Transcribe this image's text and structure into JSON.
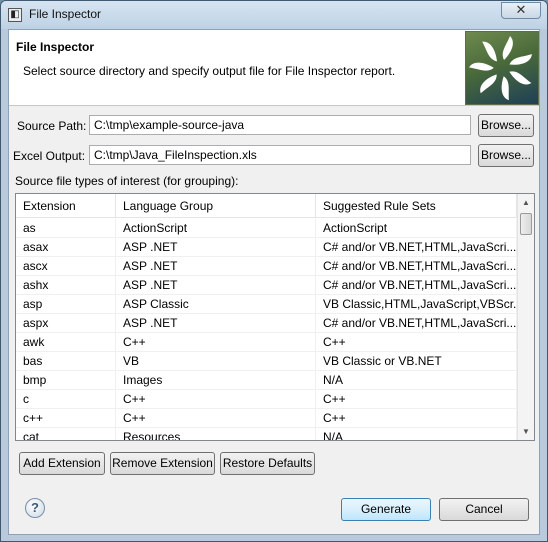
{
  "window": {
    "title": "File Inspector",
    "close_glyph": "✕"
  },
  "banner": {
    "title": "File Inspector",
    "description": "Select source directory and specify output file for File Inspector report."
  },
  "source_path": {
    "label": "Source Path:",
    "value": "C:\\tmp\\example-source-java",
    "browse_label": "Browse..."
  },
  "excel_output": {
    "label": "Excel Output:",
    "value": "C:\\tmp\\Java_FileInspection.xls",
    "browse_label": "Browse..."
  },
  "types_label": "Source file types of interest (for grouping):",
  "table": {
    "columns": [
      "Extension",
      "Language Group",
      "Suggested Rule Sets"
    ],
    "rows": [
      [
        "as",
        "ActionScript",
        "ActionScript"
      ],
      [
        "asax",
        "ASP .NET",
        "C# and/or VB.NET,HTML,JavaScri..."
      ],
      [
        "ascx",
        "ASP .NET",
        "C# and/or VB.NET,HTML,JavaScri..."
      ],
      [
        "ashx",
        "ASP .NET",
        "C# and/or VB.NET,HTML,JavaScri..."
      ],
      [
        "asp",
        "ASP Classic",
        "VB Classic,HTML,JavaScript,VBScr..."
      ],
      [
        "aspx",
        "ASP .NET",
        "C# and/or VB.NET,HTML,JavaScri..."
      ],
      [
        "awk",
        "C++",
        "C++"
      ],
      [
        "bas",
        "VB",
        "VB Classic or VB.NET"
      ],
      [
        "bmp",
        "Images",
        "N/A"
      ],
      [
        "c",
        "C++",
        "C++"
      ],
      [
        "c++",
        "C++",
        "C++"
      ],
      [
        "cat",
        "Resources",
        "N/A"
      ]
    ]
  },
  "buttons": {
    "add_extension": "Add Extension",
    "remove_extension": "Remove Extension",
    "restore_defaults": "Restore Defaults",
    "generate": "Generate",
    "cancel": "Cancel"
  },
  "help_glyph": "?",
  "icons": {
    "app": "file-inspector-app-icon",
    "logo": "pinwheel-logo-icon",
    "help": "help-icon"
  }
}
